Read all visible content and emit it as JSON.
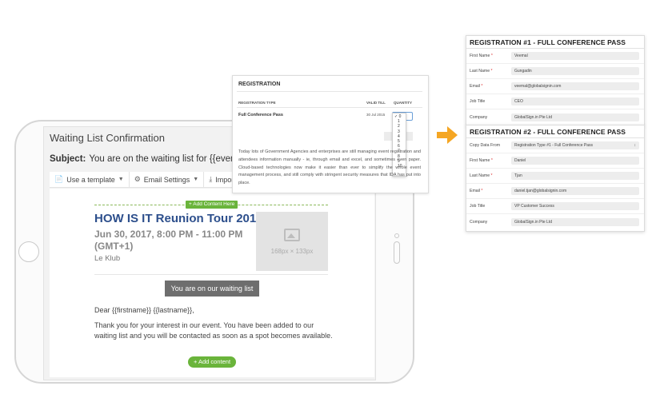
{
  "colors": {
    "accent_green": "#6ab43b",
    "title_blue": "#2d4f8c",
    "arrow_orange": "#f5a623",
    "button_gray": "#6e6e6e"
  },
  "editor": {
    "title": "Waiting List Confirmation",
    "subject_label": "Subject:",
    "subject_value": "You are on the waiting list for {{event.name}}",
    "toolbar": {
      "use_template": "Use a template",
      "email_settings": "Email Settings",
      "import_html": "Import HTML",
      "use_template_icon": "file-icon",
      "email_settings_icon": "gear-icon",
      "import_html_icon": "download-icon"
    },
    "add_content_here": "+ Add Content Here",
    "event_title": "HOW IS IT Reunion Tour 2017",
    "event_date": "Jun 30, 2017, 8:00 PM - 11:00 PM (GMT+1)",
    "event_venue": "Le Klub",
    "image_placeholder": "168px × 133px",
    "waiting_button": "You are on our waiting list",
    "greeting": "Dear {{firstname}} {{lastname}},",
    "body": "Thank you for your interest in our event. You have been added to our waiting list and you will be contacted as soon as a spot becomes available.",
    "add_content": "+ Add content"
  },
  "registration_popup": {
    "title": "REGISTRATION",
    "col_type": "REGISTRATION TYPE",
    "col_valid": "VALID TILL",
    "col_quantity": "QUANTITY",
    "pass_name": "Full Conference Pass",
    "valid_till": "30 Jul 2015",
    "quantity_selected": "0",
    "quantity_options": [
      "0",
      "1",
      "2",
      "3",
      "4",
      "5",
      "6",
      "7",
      "8",
      "9",
      "10"
    ],
    "paragraph": "Today lots of Government Agencies and enterprises are still managing event registration and attendees information manually - ie, through email and excel, and sometimes even paper. Cloud-based technologies now make it easier than ever to simplify the whole event management process, and still comply with stringent security measures that IDA has put into place."
  },
  "forms": [
    {
      "title": "REGISTRATION #1 - FULL CONFERENCE PASS",
      "fields": [
        {
          "label": "First Name",
          "required": true,
          "value": "Veemal"
        },
        {
          "label": "Last Name",
          "required": true,
          "value": "Gungadin"
        },
        {
          "label": "Email",
          "required": true,
          "value": "veemal@globalsignin.com"
        },
        {
          "label": "Job Title",
          "required": false,
          "value": "CEO"
        },
        {
          "label": "Company",
          "required": false,
          "value": "GlobalSign.in Pte Ltd"
        }
      ]
    },
    {
      "title": "REGISTRATION #2 - FULL CONFERENCE PASS",
      "fields": [
        {
          "label": "Copy Data From",
          "required": false,
          "value": "Registration Type #1 - Full Conference Pass",
          "dropdown": "↕"
        },
        {
          "label": "First Name",
          "required": true,
          "value": "Daniel"
        },
        {
          "label": "Last Name",
          "required": true,
          "value": "Tjan"
        },
        {
          "label": "Email",
          "required": true,
          "value": "daniel.tjan@globalsignin.com"
        },
        {
          "label": "Job Title",
          "required": false,
          "value": "VP Customer Success"
        },
        {
          "label": "Company",
          "required": false,
          "value": "GlobalSign.in Pte Ltd"
        }
      ]
    }
  ]
}
